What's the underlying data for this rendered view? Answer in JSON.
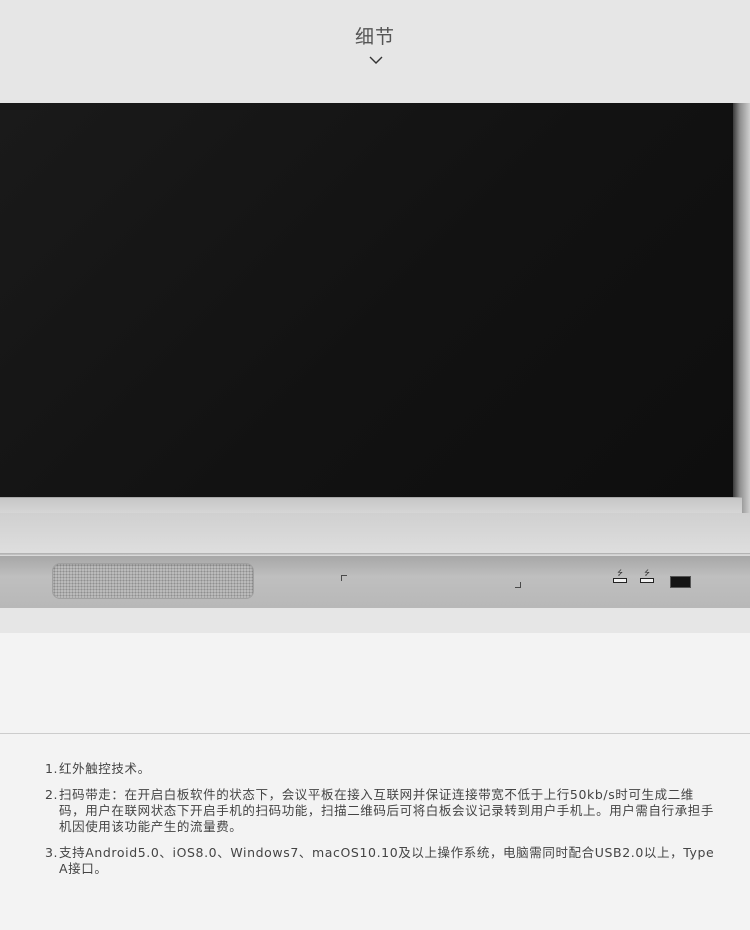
{
  "header": {
    "title": "细节"
  },
  "device": {
    "icons": {
      "chevron": "chevron-down-icon",
      "usb": "usb-icon",
      "usb_symbol": "⭍"
    }
  },
  "notes": [
    {
      "num": "1.",
      "text": "红外触控技术。"
    },
    {
      "num": "2.",
      "text": "扫码带走：在开启白板软件的状态下，会议平板在接入互联网并保证连接带宽不低于上行50kb/s时可生成二维码，用户在联网状态下开启手机的扫码功能，扫描二维码后可将白板会议记录转到用户手机上。用户需自行承担手机因使用该功能产生的流量费。"
    },
    {
      "num": "3.",
      "text": "支持Android5.0、iOS8.0、Windows7、macOS10.10及以上操作系统，电脑需同时配合USB2.0以上，Type A接口。"
    }
  ],
  "colors": {
    "background": "#f3f3f3",
    "header_bg": "#e6e6e6",
    "screen": "#121212",
    "bezel": "#c8c8c8",
    "text": "#444444"
  }
}
